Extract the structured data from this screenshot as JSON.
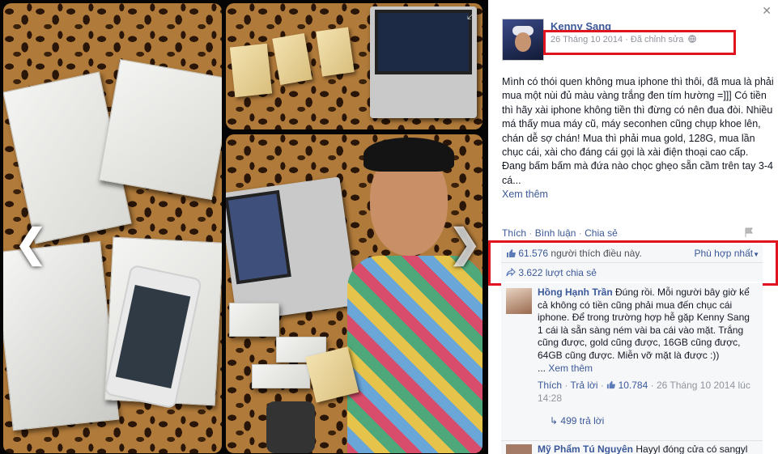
{
  "viewer": {
    "prev_glyph": "❮",
    "next_glyph": "❯",
    "expand_glyph": "⤢"
  },
  "post": {
    "author": "Kenny Sang",
    "date": "26 Tháng 10 2014",
    "edited": "Đã chỉnh sửa",
    "meta_sep": " · ",
    "privacy_icon": "globe-icon",
    "body": "Mình có thói quen không mua iphone thì thôi, đã mua là phải mua một nùi đủ màu vàng trắng đen tím hường =]]] Có tiền thì hãy xài iphone không tiền thì đừng có nên đua đòi. Nhiều má thấy mua máy cũ, máy seconhen cũng chụp khoe lên, chán dễ sợ chán! Mua thì phải mua gold, 128G, mua lần chục cái, xài cho đáng cái gọi là xài điện thoại cao cấp. Đang bấm bấm mà đứa nào chọc ghẹo sẵn cầm trên tay 3-4 cá...",
    "see_more": "Xem thêm",
    "actions": {
      "like": "Thích",
      "comment": "Bình luận",
      "share": "Chia sẻ",
      "sep": "·"
    },
    "likes_count": "61.576",
    "likes_text": "người thích điều này.",
    "sort_label": "Phù hợp nhất",
    "shares_text": "3.622 lượt chia sẻ"
  },
  "comments": [
    {
      "author": "Hồng Hạnh Trần",
      "text": "Đúng rồi. Mỗi người bây giờ kể cả không có tiền cũng phải mua đến chục cái iphone. Để trong trường hợp hễ gặp Kenny Sang 1 cái là sẵn sàng ném vài ba cái vào mặt. Trắng cũng được, gold cũng được, 16GB cũng được, 64GB cũng được. Miễn vỡ mặt là được :))",
      "see_more_prefix": "...",
      "see_more": "Xem thêm",
      "like": "Thích",
      "reply": "Trả lời",
      "like_count": "10.784",
      "time": "26 Tháng 10 2014 lúc 14:28",
      "replies": "499 trả lời"
    },
    {
      "author": "Mỹ Phẩm Tú Nguyên",
      "text": "Hayyl đóng cửa có sangyl"
    }
  ],
  "colors": {
    "link": "#3b5998",
    "highlight": "#e0141e",
    "muted": "#90949c"
  }
}
